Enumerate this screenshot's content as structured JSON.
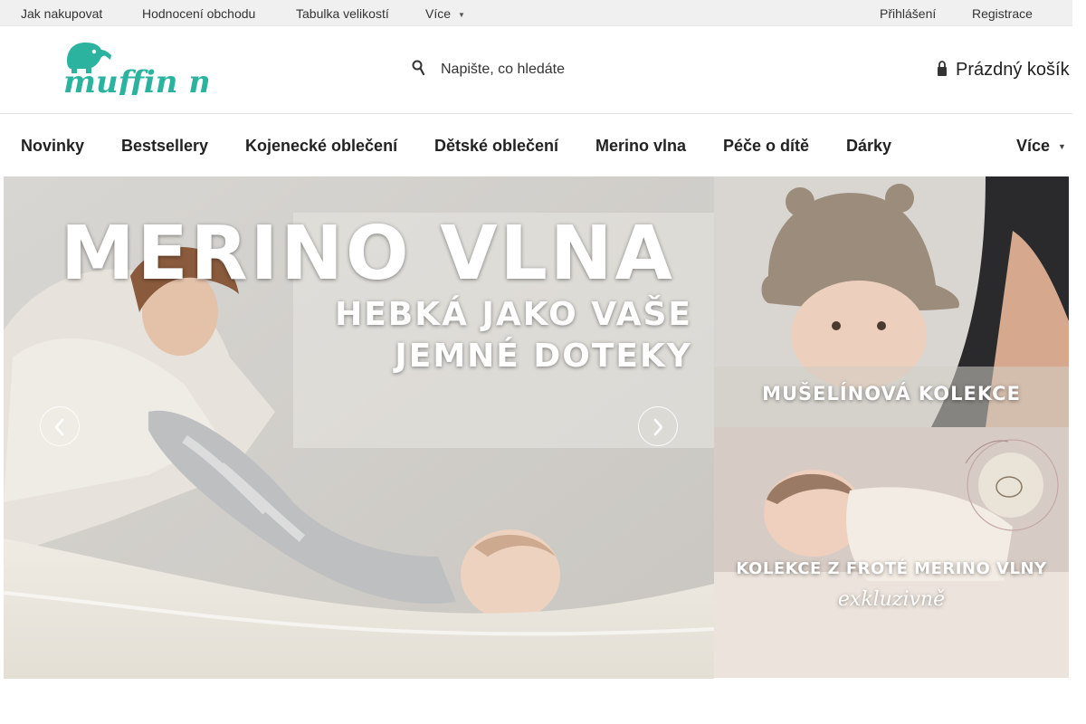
{
  "topbar": {
    "links": [
      "Jak nakupovat",
      "Hodnocení obchodu",
      "Tabulka velikostí",
      "Více"
    ],
    "auth": [
      "Přihlášení",
      "Registrace"
    ]
  },
  "header": {
    "logo_text": "muffin mode",
    "search_placeholder": "Napište, co hledáte",
    "cart_label": "Prázdný košík"
  },
  "nav": {
    "items": [
      "Novinky",
      "Bestsellery",
      "Kojenecké oblečení",
      "Dětské oblečení",
      "Merino vlna",
      "Péče o dítě",
      "Dárky"
    ],
    "more": "Více"
  },
  "banners": {
    "main": {
      "headline": "MERINO VLNA",
      "subline1": "HEBKÁ JAKO VAŠE",
      "subline2": "JEMNÉ DOTEKY"
    },
    "side1": {
      "title": "MUŠELÍNOVÁ KOLEKCE"
    },
    "side2": {
      "title": "KOLEKCE Z FROTÉ MERINO VLNY",
      "subtitle": "exkluzivně"
    }
  },
  "colors": {
    "brand": "#2bb3a0",
    "topbar_bg": "#f0f0f0"
  },
  "icons": [
    "search-icon",
    "lock-icon",
    "chevron-left-icon",
    "chevron-right-icon",
    "elephant-logo-icon"
  ]
}
